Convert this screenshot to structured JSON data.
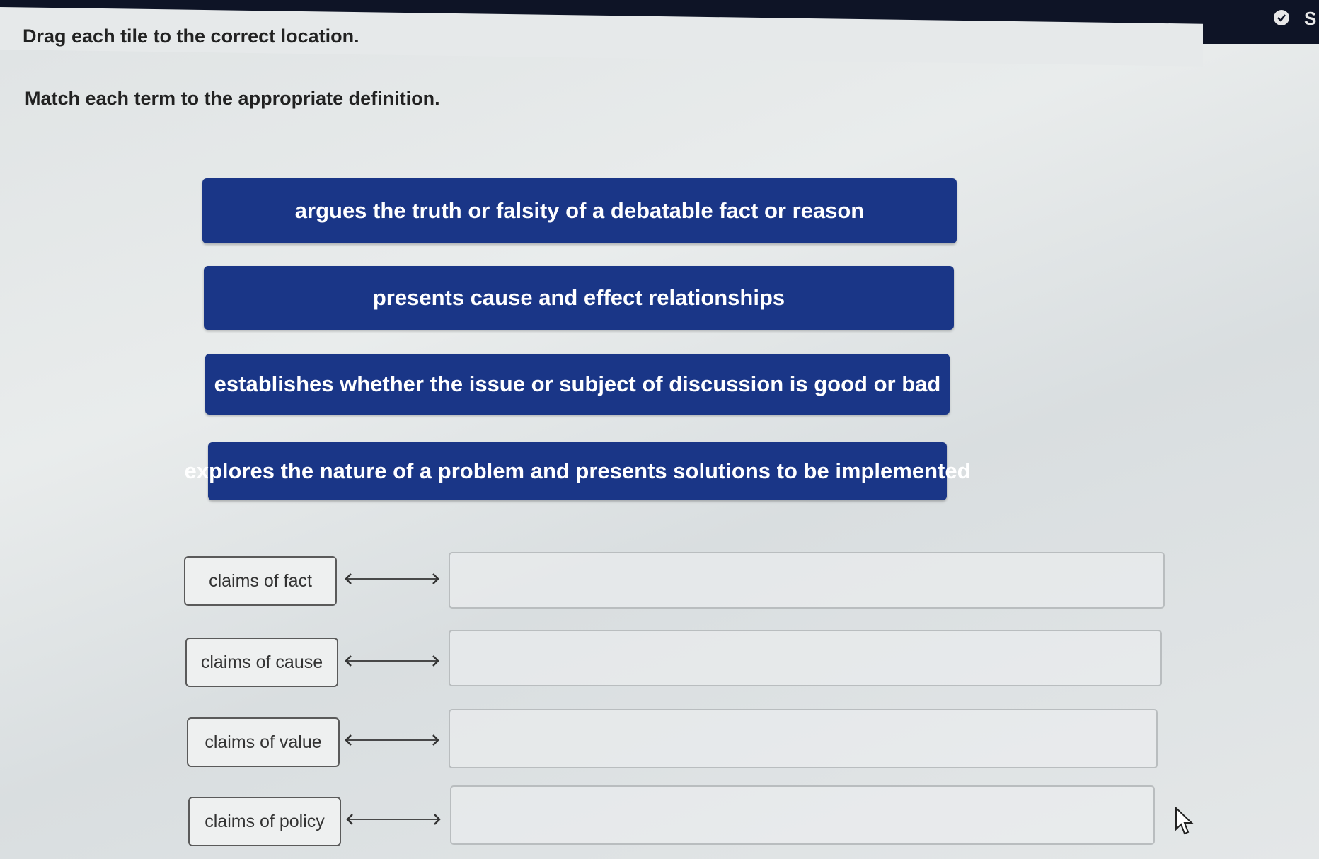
{
  "header": {
    "top_right_partial": "S",
    "status_icon": "check-circle-icon"
  },
  "instructions": {
    "drag": "Drag each tile to the correct location.",
    "match": "Match each term to the appropriate definition."
  },
  "tiles": [
    {
      "label": "argues the truth or falsity of a debatable fact or reason"
    },
    {
      "label": "presents cause and effect relationships"
    },
    {
      "label": "establishes whether the issue or subject of discussion is good or bad"
    },
    {
      "label": "explores the nature of a problem and presents solutions to be implemented"
    }
  ],
  "terms": [
    {
      "label": "claims of fact",
      "answer": ""
    },
    {
      "label": "claims of cause",
      "answer": ""
    },
    {
      "label": "claims of value",
      "answer": ""
    },
    {
      "label": "claims of policy",
      "answer": ""
    }
  ],
  "colors": {
    "tile_background": "#1a3687",
    "tile_text": "#ffffff",
    "topbar": "#0e1426"
  }
}
